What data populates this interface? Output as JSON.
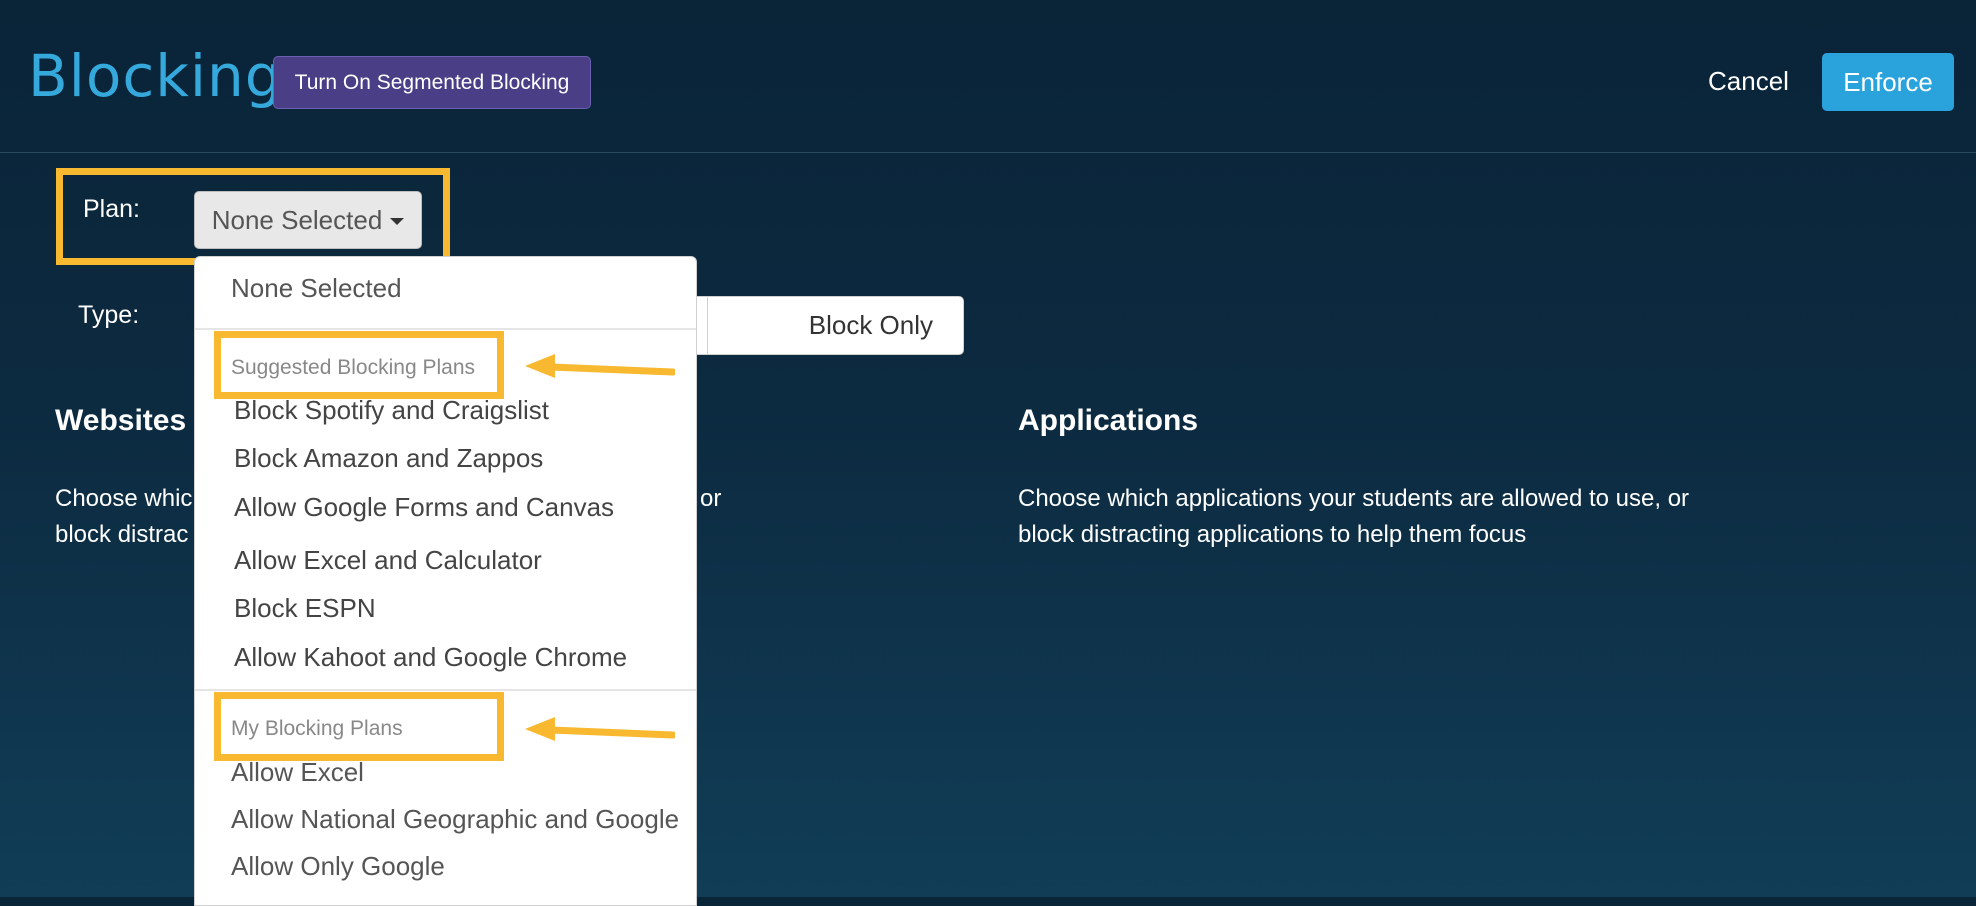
{
  "header": {
    "title": "Blocking",
    "segmented_button": "Turn On Segmented Blocking",
    "cancel": "Cancel",
    "enforce": "Enforce"
  },
  "plan": {
    "label": "Plan:",
    "selected": "None Selected"
  },
  "type": {
    "label": "Type:",
    "option_visible": "Block Only"
  },
  "websites": {
    "title": "Websites",
    "desc_line1": "Choose which",
    "desc_line1_end": "or",
    "desc_line2": "block distrac"
  },
  "applications": {
    "title": "Applications",
    "desc_line1": "Choose which applications your students are allowed to use, or",
    "desc_line2": "block distracting applications to help them focus"
  },
  "dropdown": {
    "none_option": "None Selected",
    "suggested_header": "Suggested Blocking Plans",
    "suggested_items": [
      "Block Spotify and Craigslist",
      "Block Amazon and Zappos",
      "Allow Google Forms and Canvas",
      "Allow Excel and Calculator",
      "Block ESPN",
      "Allow Kahoot and Google Chrome"
    ],
    "my_header": "My Blocking Plans",
    "my_items": [
      "Allow Excel",
      "Allow National Geographic and Google",
      "Allow Only Google"
    ]
  },
  "colors": {
    "accent": "#35a8dc",
    "enforce_button": "#2aa3dc",
    "segmented_button": "#4a3f86",
    "highlight": "#f8b830",
    "background_top": "#0a2438",
    "background_bottom": "#113d57"
  }
}
